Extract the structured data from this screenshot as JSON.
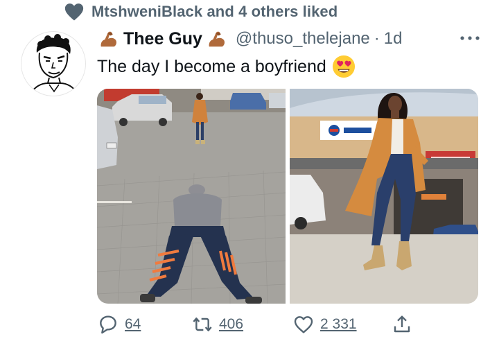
{
  "social_context": {
    "text": "MtshweniBlack and 4 others liked",
    "icon": "heart-icon"
  },
  "tweet": {
    "author_name": "Thee Guy",
    "author_icon": "flexed-biceps-icon",
    "handle": "@thuso_thelejane",
    "separator": "·",
    "time": "1d",
    "text": "The day I become a boyfriend",
    "emoji": "heart-eyes-emoji-icon",
    "media": [
      {
        "icon": "photo-man-lying-on-pavement"
      },
      {
        "icon": "photo-woman-posing-in-front-of-shop"
      }
    ]
  },
  "actions": {
    "reply_count": "64",
    "retweet_count": "406",
    "like_count": "2 331"
  },
  "colors": {
    "secondary_text": "#536471",
    "primary_text": "#0f1419",
    "background": "#ffffff"
  }
}
